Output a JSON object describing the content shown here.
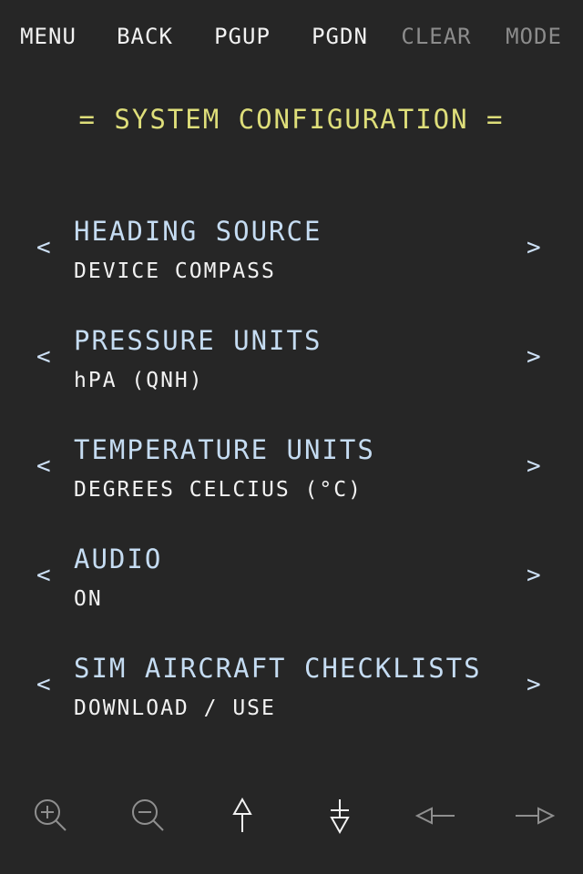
{
  "toolbar": {
    "menu": "MENU",
    "back": "BACK",
    "pgup": "PGUP",
    "pgdn": "PGDN",
    "clear": "CLEAR",
    "mode": "MODE"
  },
  "page_title": "= SYSTEM CONFIGURATION =",
  "settings": [
    {
      "name": "HEADING SOURCE",
      "value": "DEVICE COMPASS"
    },
    {
      "name": "PRESSURE UNITS",
      "value": "hPA (QNH)"
    },
    {
      "name": "TEMPERATURE UNITS",
      "value": "DEGREES CELCIUS (°C)"
    },
    {
      "name": "AUDIO",
      "value": "ON"
    },
    {
      "name": "SIM AIRCRAFT CHECKLISTS",
      "value": "DOWNLOAD / USE"
    }
  ],
  "arrows": {
    "prev": "<",
    "next": ">"
  },
  "bottom_icons": [
    "zoom-in-icon",
    "zoom-out-icon",
    "arrow-up-icon",
    "arrow-down-icon",
    "arrow-left-icon",
    "arrow-right-icon"
  ],
  "colors": {
    "background": "#262626",
    "title": "#dede7a",
    "setting_name": "#c5dcf2",
    "setting_value": "#f2f2f2",
    "disabled": "#8c8c8c"
  }
}
